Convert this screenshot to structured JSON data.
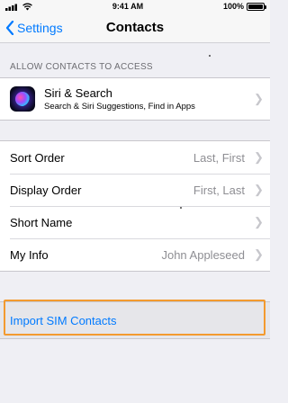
{
  "status_bar": {
    "time": "9:41 AM",
    "battery_percent": "100%",
    "signal_icon": "signal-bars-icon",
    "wifi_icon": "wifi-icon"
  },
  "nav": {
    "back_label": "Settings",
    "title": "Contacts"
  },
  "access_section": {
    "header": "ALLOW CONTACTS TO ACCESS",
    "siri": {
      "title": "Siri & Search",
      "subtitle": "Search & Siri Suggestions, Find in Apps",
      "icon": "siri-icon"
    }
  },
  "settings_rows": [
    {
      "label": "Sort Order",
      "value": "Last, First"
    },
    {
      "label": "Display Order",
      "value": "First, Last"
    },
    {
      "label": "Short Name",
      "value": ""
    },
    {
      "label": "My Info",
      "value": "John Appleseed"
    }
  ],
  "import_action": {
    "label": "Import SIM Contacts",
    "highlight_color": "#f39a2f"
  },
  "colors": {
    "accent": "#007aff",
    "background": "#efeff4",
    "secondary_text": "#8e8e93"
  }
}
